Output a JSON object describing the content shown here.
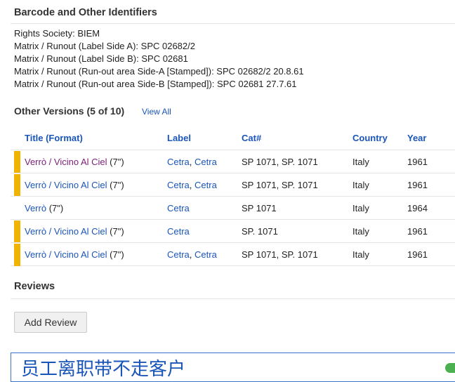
{
  "identifiers": {
    "title": "Barcode and Other Identifiers",
    "lines": [
      "Rights Society: BIEM",
      "Matrix / Runout (Label Side A): SPC 02682/2",
      "Matrix / Runout (Label Side B): SPC 02681",
      "Matrix / Runout (Run-out area Side-A [Stamped]): SPC 02682/2 20.8.61",
      "Matrix / Runout (Run-out area Side-B [Stamped]): SPC 02681 27.7.61"
    ]
  },
  "other_versions": {
    "title": "Other Versions (5 of 10)",
    "view_all": "View All",
    "headers": {
      "title": "Title (Format)",
      "label": "Label",
      "cat": "Cat#",
      "country": "Country",
      "year": "Year"
    },
    "rows": [
      {
        "highlight": true,
        "visited": true,
        "title": "Verrò / Vicino Al Ciel",
        "format": "(7\")",
        "label1": "Cetra",
        "label_sep": ", ",
        "label2": "Cetra",
        "cat": "SP 1071, SP. 1071",
        "country": "Italy",
        "year": "1961"
      },
      {
        "highlight": true,
        "visited": false,
        "title": "Verrò / Vicino Al Ciel",
        "format": "(7\")",
        "label1": "Cetra",
        "label_sep": ", ",
        "label2": "Cetra",
        "cat": "SP 1071, SP. 1071",
        "country": "Italy",
        "year": "1961"
      },
      {
        "highlight": false,
        "visited": false,
        "title": "Verrò",
        "format": "(7\")",
        "label1": "Cetra",
        "label_sep": "",
        "label2": "",
        "cat": "SP 1071",
        "country": "Italy",
        "year": "1964"
      },
      {
        "highlight": true,
        "visited": false,
        "title": "Verrò / Vicino Al Ciel",
        "format": "(7\")",
        "label1": "Cetra",
        "label_sep": "",
        "label2": "",
        "cat": "SP. 1071",
        "country": "Italy",
        "year": "1961"
      },
      {
        "highlight": true,
        "visited": false,
        "title": "Verrò / Vicino Al Ciel",
        "format": "(7\")",
        "label1": "Cetra",
        "label_sep": ", ",
        "label2": "Cetra",
        "cat": "SP 1071, SP. 1071",
        "country": "Italy",
        "year": "1961"
      }
    ]
  },
  "reviews": {
    "title": "Reviews",
    "add_label": "Add Review"
  },
  "ad": {
    "text": "员工离职带不走客户"
  },
  "colors": {
    "link": "#1a55b8",
    "visited_link": "#7b1e7a",
    "highlight_marker": "#f0b400"
  }
}
